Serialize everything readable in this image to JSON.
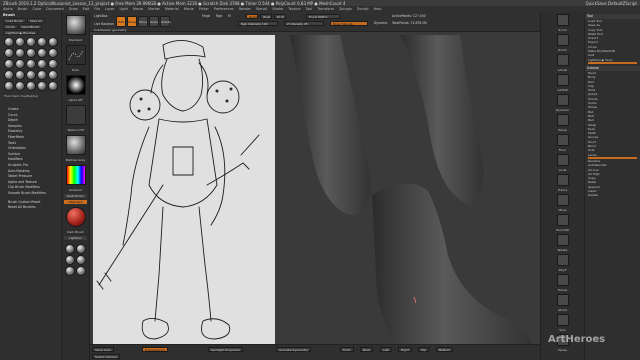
{
  "title_bar": {
    "text": "ZBrush 2019.1.2    OpticalIllusionist_Lesson_12_project    ● Free Mem 39.996GB  ● Active Mem 3216  ● Scratch Disk 3788  ● Timer 0.544  ● PolyCount 0.83 MP  ● MeshCount 4",
    "right": "QuickSave    DefaultZScript"
  },
  "menu": [
    "Alpha",
    "Brush",
    "Color",
    "Document",
    "Draw",
    "Edit",
    "File",
    "Layer",
    "Light",
    "Macro",
    "Marker",
    "Material",
    "Movie",
    "Picker",
    "Preferences",
    "Render",
    "Stencil",
    "Stroke",
    "Texture",
    "Tool",
    "Transform",
    "Zplugin",
    "Zscript",
    "Help"
  ],
  "left_panel": {
    "title": "Brush",
    "buttons": [
      "Load Brush",
      "Save As",
      "Clone",
      "SelectBrush",
      "Lightbox ▶ Brushes"
    ],
    "menu_items": [
      "Create",
      "Curve",
      "Depth",
      "Samples",
      "Elasticity",
      "FiberMesh",
      "Twist",
      "Orientation",
      "Surface",
      "Modifiers",
      "Sculptris Pro",
      "Auto Masking",
      "Tablet Pressure",
      "Alpha and Texture",
      "Clip Brush Modifiers",
      "Smooth Brush Modifiers",
      "Brush Custom Reset",
      "Reset All Brushes"
    ],
    "brush_caption": "Fluid Dam    ClayBuildup"
  },
  "left_tray": {
    "labels": [
      "Standard",
      "Dots",
      "Alpha Off",
      "Texture Off",
      "MatCap Gray",
      "Gradient",
      "SwitchColor",
      "Alternate",
      "Dark Brush",
      "Lightbox"
    ]
  },
  "top_bar": {
    "buttons": [
      "LightBox",
      "Live Boolean",
      "Edit",
      "Draw",
      "Move",
      "Scale",
      "Rotate"
    ],
    "sliders": {
      "mrgb": "Mrgb",
      "rgb": "Rgb",
      "m": "M",
      "zadd": "Zadd",
      "zsub": "Zsub",
      "zcut": "Zcut",
      "focal_shift": "Focal Shift 0",
      "draw_size": "Draw Size 64",
      "z_intensity": "Z Intensity 25",
      "rgb_intensity": "Rgb Intensity 100",
      "dynamic": "Dynamic",
      "active_points": "ActivePoints: 127,040",
      "total_points": "TotalPoints: 73.878 Mil",
      "spotlight": "Spotlight Projection",
      "subdivide": "Subdivide Smooth",
      "sym": "Symmetry",
      "geom": "Subdivision geometry"
    }
  },
  "bottom_bar": [
    "Store Cam",
    "Select Camera",
    "Transparency",
    "Spotlight Projection",
    "Animate Symmetry",
    "Front",
    "Back",
    "Left",
    "Right",
    "Top",
    "Bottom"
  ],
  "right_tray": {
    "labels": [
      "Scroll",
      "Zoom",
      "Actual",
      "AAHalf",
      "Dynamic",
      "Persp",
      "Floor",
      "Local",
      "Frame",
      "Move",
      "Zoom3D",
      "Rotate",
      "PolyF",
      "Transp",
      "Ghost",
      "Solo",
      "Xpose"
    ]
  },
  "right_panel": {
    "tool_title": "Tool",
    "buttons": [
      "Load Tool",
      "Save As",
      "Copy Tool",
      "Paste Tool",
      "Import",
      "Export",
      "Clone",
      "Make PolyMesh3D",
      "GoZ",
      "All",
      "Visible",
      "R",
      "Lightbox ▶ Tools"
    ],
    "subtool_title": "Subtool",
    "subtools": [
      "Head",
      "Body",
      "Hair",
      "Cap",
      "Shirt",
      "Jacket",
      "Shorts",
      "Socks",
      "Shoes",
      "Bat",
      "Belt",
      "Ball",
      "Strap",
      "Eyes",
      "Teeth",
      "Gloves",
      "Hood",
      "Band",
      "Sole",
      "Laces",
      "Pins",
      "Tape"
    ],
    "bottom_items": [
      "Rename",
      "AutoReorder",
      "All Low",
      "All High",
      "Copy",
      "Paste",
      "Append",
      "Insert",
      "Delete",
      "Del Other",
      "Del All",
      "Split",
      "Merge",
      "Remesh",
      "Project"
    ],
    "watermark": "ArtHeroes"
  }
}
